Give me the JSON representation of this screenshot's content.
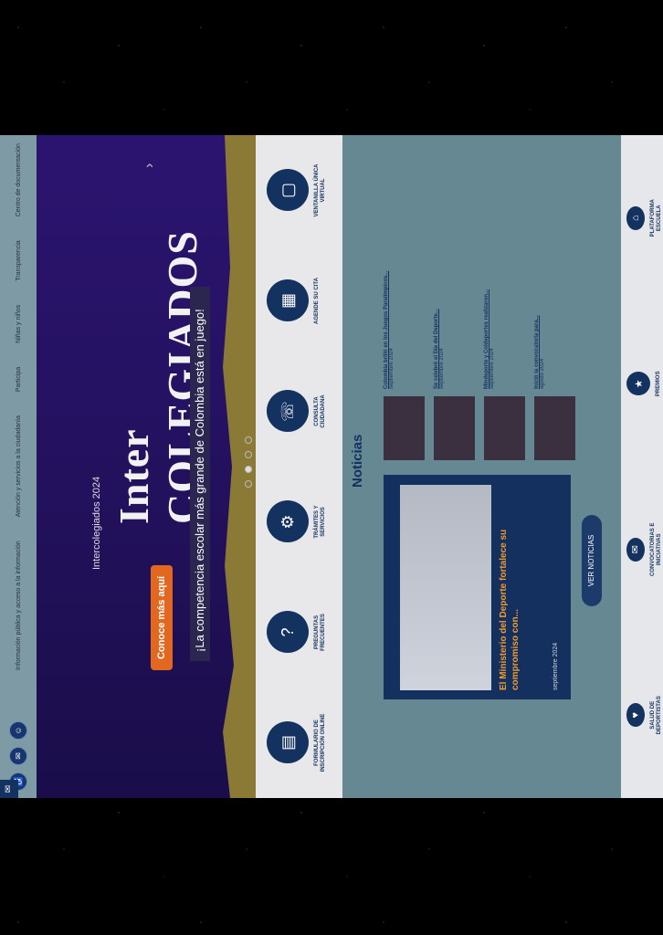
{
  "topbar": {
    "links": [
      "Información pública y acceso a la información",
      "Atención y servicios a la ciudadanía",
      "Participa",
      "Niñas y niños",
      "Transparencia",
      "Centro de documentación"
    ],
    "icons": [
      "accessibility-icon",
      "chat-icon",
      "user-icon"
    ]
  },
  "hero": {
    "subtitle": "Intercolegiados 2024",
    "title": "Inter COLEGIADOS",
    "banner": "¡La competencia escolar más grande de Colombia está en juego!",
    "cta": "Conoce más aquí",
    "slides": 4,
    "active_slide": 2
  },
  "services": [
    {
      "label": "FORMULARIO DE INSCRIPCIÓN ONLINE",
      "icon": "form-icon"
    },
    {
      "label": "PREGUNTAS FRECUENTES",
      "icon": "question-icon"
    },
    {
      "label": "TRÁMITES Y SERVICIOS",
      "icon": "gear-icon"
    },
    {
      "label": "CONSULTA CIUDADANA",
      "icon": "headset-icon"
    },
    {
      "label": "AGENDE SU CITA",
      "icon": "calendar-icon"
    },
    {
      "label": "VENTANILLA ÚNICA VIRTUAL",
      "icon": "window-icon"
    }
  ],
  "news": {
    "heading": "Noticias",
    "featured": {
      "title": "El Ministerio del Deporte fortalece su compromiso con...",
      "date": "septiembre 2024"
    },
    "items": [
      {
        "title": "Colombia brilló en los Juegos Paralímpicos...",
        "date": "septiembre 2024"
      },
      {
        "title": "Se celebró el Día del Deporte...",
        "date": "septiembre 2024"
      },
      {
        "title": "Mindeporte y Coldeportes realizaron...",
        "date": "septiembre 2024"
      },
      {
        "title": "Inició la convocatoria para...",
        "date": "agosto 2024"
      }
    ],
    "button": "VER NOTICIAS"
  },
  "bottom": [
    {
      "label": "SALUD DE DEPORTISTAS",
      "icon": "heart-icon"
    },
    {
      "label": "CONVOCATORIAS E INICIATIVAS",
      "icon": "megaphone-icon"
    },
    {
      "label": "PREMIOS",
      "icon": "trophy-icon"
    },
    {
      "label": "PLATAFORMA ESCUELA",
      "icon": "school-icon"
    }
  ]
}
